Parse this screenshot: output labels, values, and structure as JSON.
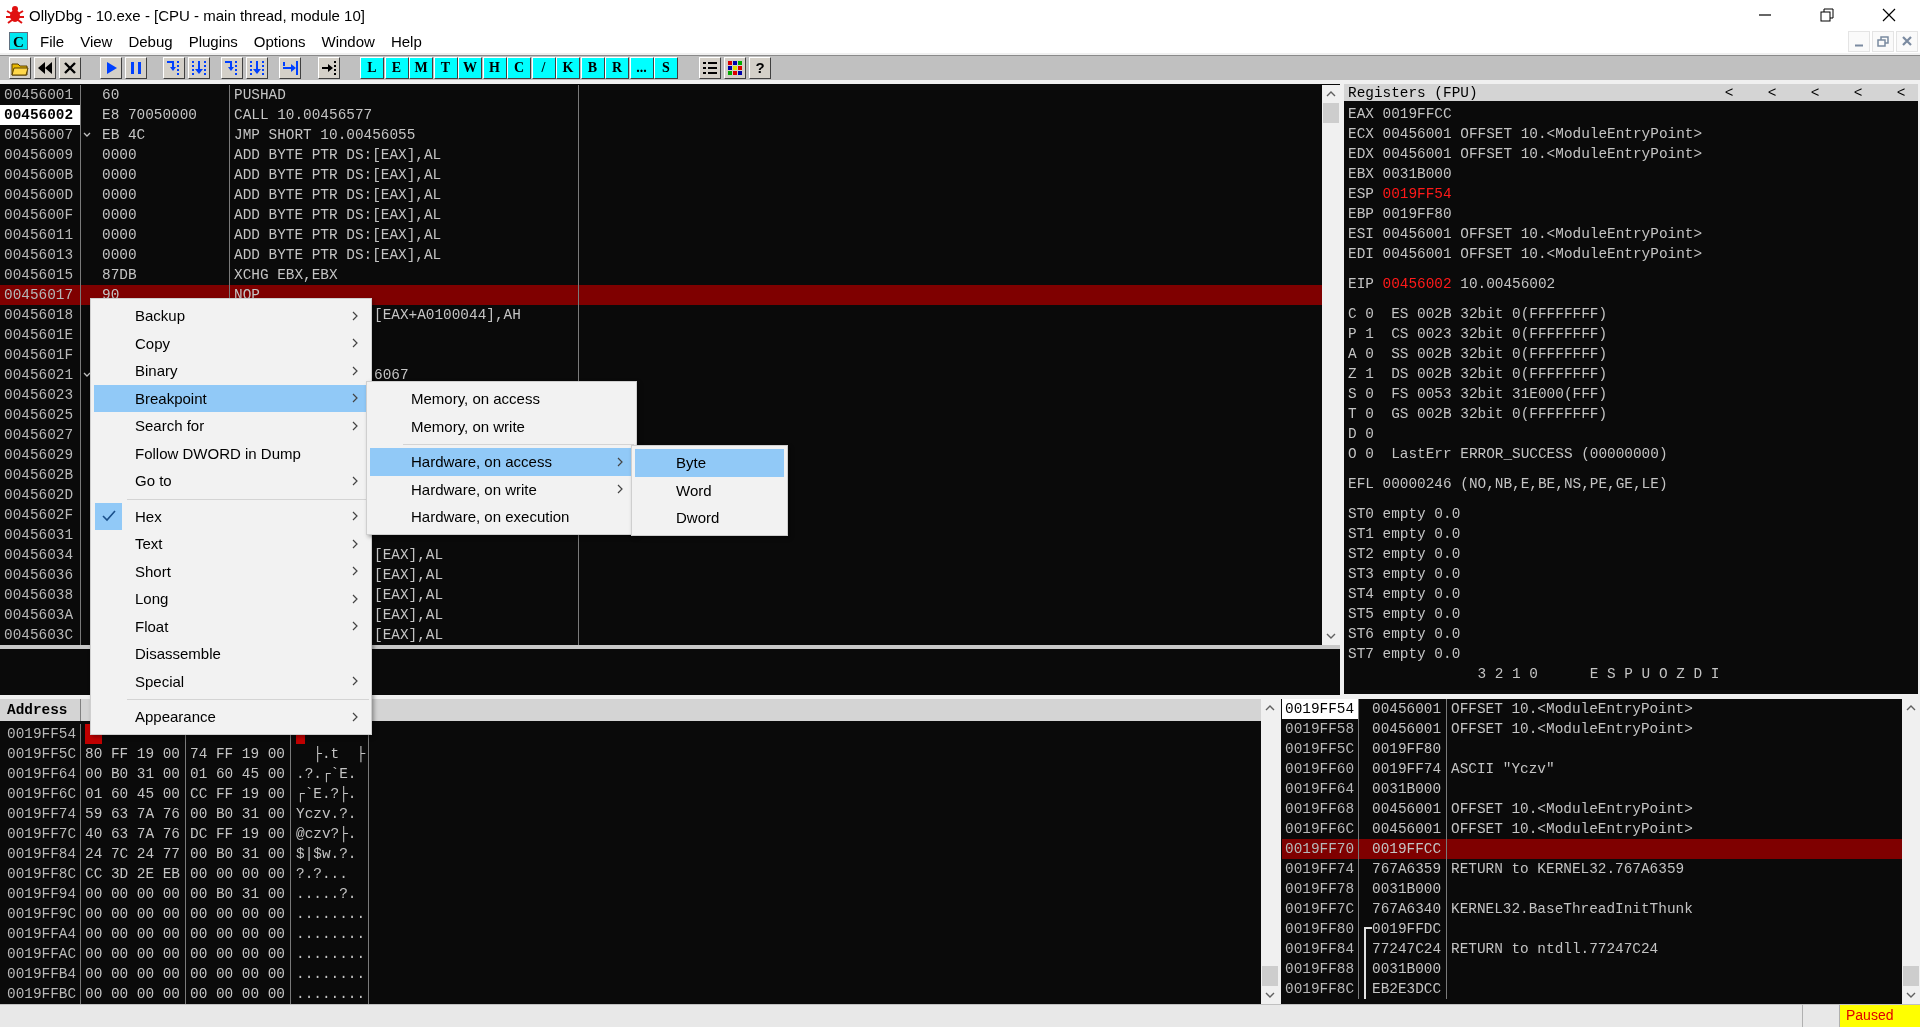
{
  "window": {
    "title": "OllyDbg - 10.exe - [CPU - main thread, module 10]"
  },
  "menu_bar": {
    "badge": "C",
    "items": [
      "File",
      "View",
      "Debug",
      "Plugins",
      "Options",
      "Window",
      "Help"
    ]
  },
  "toolbar": {
    "letter_buttons": [
      "L",
      "E",
      "M",
      "T",
      "W",
      "H",
      "C",
      "/",
      "K",
      "B",
      "R",
      "...",
      "S"
    ],
    "help_button": "?"
  },
  "disassembly": {
    "rows": [
      {
        "address": "00456001",
        "hex": "60",
        "command": "PUSHAD",
        "kind": "full",
        "current": false,
        "selected": false,
        "jump": false
      },
      {
        "address": "00456002",
        "hex": "E8 70050000",
        "command": "CALL 10.00456577",
        "kind": "full",
        "current": true,
        "selected": false,
        "jump": false
      },
      {
        "address": "00456007",
        "hex": "EB 4C",
        "command": "JMP SHORT 10.00456055",
        "kind": "full",
        "current": false,
        "selected": false,
        "jump": true
      },
      {
        "address": "00456009",
        "hex": "0000",
        "command": "ADD BYTE PTR DS:[EAX],AL",
        "kind": "full",
        "current": false,
        "selected": false,
        "jump": false
      },
      {
        "address": "0045600B",
        "hex": "0000",
        "command": "ADD BYTE PTR DS:[EAX],AL",
        "kind": "full",
        "current": false,
        "selected": false,
        "jump": false
      },
      {
        "address": "0045600D",
        "hex": "0000",
        "command": "ADD BYTE PTR DS:[EAX],AL",
        "kind": "full",
        "current": false,
        "selected": false,
        "jump": false
      },
      {
        "address": "0045600F",
        "hex": "0000",
        "command": "ADD BYTE PTR DS:[EAX],AL",
        "kind": "full",
        "current": false,
        "selected": false,
        "jump": false
      },
      {
        "address": "00456011",
        "hex": "0000",
        "command": "ADD BYTE PTR DS:[EAX],AL",
        "kind": "full",
        "current": false,
        "selected": false,
        "jump": false
      },
      {
        "address": "00456013",
        "hex": "0000",
        "command": "ADD BYTE PTR DS:[EAX],AL",
        "kind": "full",
        "current": false,
        "selected": false,
        "jump": false
      },
      {
        "address": "00456015",
        "hex": "87DB",
        "command": "XCHG EBX,EBX",
        "kind": "full",
        "current": false,
        "selected": false,
        "jump": false
      },
      {
        "address": "00456017",
        "hex": "90",
        "command": "NOP",
        "kind": "full",
        "current": false,
        "selected": true,
        "jump": false
      },
      {
        "address": "00456018",
        "command": "[EAX+A0100044],AH",
        "kind": "tail",
        "current": false,
        "selected": false,
        "jump": false
      },
      {
        "address": "0045601E",
        "kind": "tail",
        "current": false,
        "selected": false,
        "jump": false
      },
      {
        "address": "0045601F",
        "kind": "tail",
        "current": false,
        "selected": false,
        "jump": false
      },
      {
        "address": "00456021",
        "command": "6067",
        "kind": "tail",
        "current": false,
        "selected": false,
        "jump": true
      },
      {
        "address": "00456023",
        "kind": "tail",
        "current": false,
        "selected": false,
        "jump": false
      },
      {
        "address": "00456025",
        "kind": "tail",
        "current": false,
        "selected": false,
        "jump": false
      },
      {
        "address": "00456027",
        "kind": "tail",
        "current": false,
        "selected": false,
        "jump": false
      },
      {
        "address": "00456029",
        "kind": "tail",
        "current": false,
        "selected": false,
        "jump": false
      },
      {
        "address": "0045602B",
        "kind": "tail",
        "current": false,
        "selected": false,
        "jump": false
      },
      {
        "address": "0045602D",
        "kind": "tail",
        "current": false,
        "selected": false,
        "jump": false
      },
      {
        "address": "0045602F",
        "kind": "tail",
        "current": false,
        "selected": false,
        "jump": false
      },
      {
        "address": "00456031",
        "kind": "tail",
        "current": false,
        "selected": false,
        "jump": false
      },
      {
        "address": "00456034",
        "command": "[EAX],AL",
        "kind": "tail",
        "current": false,
        "selected": false,
        "jump": false
      },
      {
        "address": "00456036",
        "command": "[EAX],AL",
        "kind": "tail",
        "current": false,
        "selected": false,
        "jump": false
      },
      {
        "address": "00456038",
        "command": "[EAX],AL",
        "kind": "tail",
        "current": false,
        "selected": false,
        "jump": false
      },
      {
        "address": "0045603A",
        "command": "[EAX],AL",
        "kind": "tail",
        "current": false,
        "selected": false,
        "jump": false
      },
      {
        "address": "0045603C",
        "command": "[EAX],AL",
        "kind": "tail",
        "current": false,
        "selected": false,
        "jump": false
      }
    ]
  },
  "registers": {
    "title": "Registers (FPU)",
    "arrows": [
      "<",
      "<",
      "<",
      "<",
      "<"
    ],
    "groups": [
      [
        {
          "kind": "reg",
          "name": "EAX",
          "value": "0019FFCC",
          "changed": false
        },
        {
          "kind": "reg",
          "name": "ECX",
          "value": "00456001",
          "comment": "OFFSET 10.<ModuleEntryPoint>",
          "changed": false
        },
        {
          "kind": "reg",
          "name": "EDX",
          "value": "00456001",
          "comment": "OFFSET 10.<ModuleEntryPoint>",
          "changed": false
        },
        {
          "kind": "reg",
          "name": "EBX",
          "value": "0031B000",
          "changed": false
        },
        {
          "kind": "reg",
          "name": "ESP",
          "value": "0019FF54",
          "changed": true
        },
        {
          "kind": "reg",
          "name": "EBP",
          "value": "0019FF80",
          "changed": false
        },
        {
          "kind": "reg",
          "name": "ESI",
          "value": "00456001",
          "comment": "OFFSET 10.<ModuleEntryPoint>",
          "changed": false
        },
        {
          "kind": "reg",
          "name": "EDI",
          "value": "00456001",
          "comment": "OFFSET 10.<ModuleEntryPoint>",
          "changed": false
        }
      ],
      [
        {
          "kind": "reg",
          "name": "EIP",
          "value": "00456002",
          "comment": "10.00456002",
          "changed": true
        }
      ],
      [
        {
          "kind": "flag",
          "name": "C",
          "value": "0",
          "comment": "ES 002B 32bit 0(FFFFFFFF)",
          "changed": false
        },
        {
          "kind": "flag",
          "name": "P",
          "value": "1",
          "comment": "CS 0023 32bit 0(FFFFFFFF)",
          "changed": false
        },
        {
          "kind": "flag",
          "name": "A",
          "value": "0",
          "comment": "SS 002B 32bit 0(FFFFFFFF)",
          "changed": false
        },
        {
          "kind": "flag",
          "name": "Z",
          "value": "1",
          "comment": "DS 002B 32bit 0(FFFFFFFF)",
          "changed": false
        },
        {
          "kind": "flag",
          "name": "S",
          "value": "0",
          "comment": "FS 0053 32bit 31E000(FFF)",
          "changed": false
        },
        {
          "kind": "flag",
          "name": "T",
          "value": "0",
          "comment": "GS 002B 32bit 0(FFFFFFFF)",
          "changed": false
        },
        {
          "kind": "flag",
          "name": "D",
          "value": "0",
          "changed": false
        },
        {
          "kind": "flag",
          "name": "O",
          "value": "0",
          "comment": "LastErr ERROR_SUCCESS (00000000)",
          "changed": false
        }
      ],
      [
        {
          "kind": "reg",
          "name": "EFL",
          "value": "00000246",
          "comment": "(NO,NB,E,BE,NS,PE,GE,LE)",
          "changed": false
        }
      ],
      [
        {
          "kind": "reg",
          "name": "ST0",
          "value": "empty",
          "comment": "0.0",
          "changed": false
        },
        {
          "kind": "reg",
          "name": "ST1",
          "value": "empty",
          "comment": "0.0",
          "changed": false
        },
        {
          "kind": "reg",
          "name": "ST2",
          "value": "empty",
          "comment": "0.0",
          "changed": false
        },
        {
          "kind": "reg",
          "name": "ST3",
          "value": "empty",
          "comment": "0.0",
          "changed": false
        },
        {
          "kind": "reg",
          "name": "ST4",
          "value": "empty",
          "comment": "0.0",
          "changed": false
        },
        {
          "kind": "reg",
          "name": "ST5",
          "value": "empty",
          "comment": "0.0",
          "changed": false
        },
        {
          "kind": "reg",
          "name": "ST6",
          "value": "empty",
          "comment": "0.0",
          "changed": false
        },
        {
          "kind": "reg",
          "name": "ST7",
          "value": "empty",
          "comment": "0.0",
          "changed": false
        },
        {
          "kind": "footer",
          "text": "3 2 1 0      E S P U O Z D I",
          "changed": false
        }
      ]
    ]
  },
  "dump": {
    "columns": [
      "Address"
    ],
    "rows": [
      {
        "address": "0019FF54",
        "cursor": true
      },
      {
        "address": "0019FF5C",
        "hex": [
          "80",
          "FF",
          "19",
          "00",
          "74",
          "FF",
          "19",
          "00"
        ],
        "ascii": "  ├.t  ├",
        "cursor": false
      },
      {
        "address": "0019FF64",
        "hex": [
          "00",
          "B0",
          "31",
          "00",
          "01",
          "60",
          "45",
          "00"
        ],
        "ascii": ".?.┌`E.",
        "cursor": false
      },
      {
        "address": "0019FF6C",
        "hex": [
          "01",
          "60",
          "45",
          "00",
          "CC",
          "FF",
          "19",
          "00"
        ],
        "ascii": "┌`E.?├.",
        "cursor": false
      },
      {
        "address": "0019FF74",
        "hex": [
          "59",
          "63",
          "7A",
          "76",
          "00",
          "B0",
          "31",
          "00"
        ],
        "ascii": "Yczv.?.",
        "cursor": false
      },
      {
        "address": "0019FF7C",
        "hex": [
          "40",
          "63",
          "7A",
          "76",
          "DC",
          "FF",
          "19",
          "00"
        ],
        "ascii": "@czv?├.",
        "cursor": false
      },
      {
        "address": "0019FF84",
        "hex": [
          "24",
          "7C",
          "24",
          "77",
          "00",
          "B0",
          "31",
          "00"
        ],
        "ascii": "$|$w.?.",
        "cursor": false
      },
      {
        "address": "0019FF8C",
        "hex": [
          "CC",
          "3D",
          "2E",
          "EB",
          "00",
          "00",
          "00",
          "00"
        ],
        "ascii": "?.?...",
        "cursor": false
      },
      {
        "address": "0019FF94",
        "hex": [
          "00",
          "00",
          "00",
          "00",
          "00",
          "B0",
          "31",
          "00"
        ],
        "ascii": ".....?.",
        "cursor": false
      },
      {
        "address": "0019FF9C",
        "hex": [
          "00",
          "00",
          "00",
          "00",
          "00",
          "00",
          "00",
          "00"
        ],
        "ascii": "........",
        "cursor": false
      },
      {
        "address": "0019FFA4",
        "hex": [
          "00",
          "00",
          "00",
          "00",
          "00",
          "00",
          "00",
          "00"
        ],
        "ascii": "........",
        "cursor": false
      },
      {
        "address": "0019FFAC",
        "hex": [
          "00",
          "00",
          "00",
          "00",
          "00",
          "00",
          "00",
          "00"
        ],
        "ascii": "........",
        "cursor": false
      },
      {
        "address": "0019FFB4",
        "hex": [
          "00",
          "00",
          "00",
          "00",
          "00",
          "00",
          "00",
          "00"
        ],
        "ascii": "........",
        "cursor": false
      },
      {
        "address": "0019FFBC",
        "hex": [
          "00",
          "00",
          "00",
          "00",
          "00",
          "00",
          "00",
          "00"
        ],
        "ascii": "........",
        "cursor": false
      }
    ]
  },
  "stack": {
    "rows": [
      {
        "address": "0019FF54",
        "value": "00456001",
        "comment": "OFFSET 10.<ModuleEntryPoint>",
        "top": true,
        "selected": false,
        "frame": false
      },
      {
        "address": "0019FF58",
        "value": "00456001",
        "comment": "OFFSET 10.<ModuleEntryPoint>",
        "top": false,
        "selected": false,
        "frame": false
      },
      {
        "address": "0019FF5C",
        "value": "0019FF80",
        "top": false,
        "selected": false,
        "frame": false
      },
      {
        "address": "0019FF60",
        "value": "0019FF74",
        "comment": "ASCII \"Yczv\"",
        "top": false,
        "selected": false,
        "frame": false
      },
      {
        "address": "0019FF64",
        "value": "0031B000",
        "top": false,
        "selected": false,
        "frame": false
      },
      {
        "address": "0019FF68",
        "value": "00456001",
        "comment": "OFFSET 10.<ModuleEntryPoint>",
        "top": false,
        "selected": false,
        "frame": false
      },
      {
        "address": "0019FF6C",
        "value": "00456001",
        "comment": "OFFSET 10.<ModuleEntryPoint>",
        "top": false,
        "selected": false,
        "frame": false
      },
      {
        "address": "0019FF70",
        "value": "0019FFCC",
        "top": false,
        "selected": true,
        "frame": false
      },
      {
        "address": "0019FF74",
        "value": "767A6359",
        "comment": "RETURN to KERNEL32.767A6359",
        "top": false,
        "selected": false,
        "frame": false
      },
      {
        "address": "0019FF78",
        "value": "0031B000",
        "top": false,
        "selected": false,
        "frame": false
      },
      {
        "address": "0019FF7C",
        "value": "767A6340",
        "comment": "KERNEL32.BaseThreadInitThunk",
        "top": false,
        "selected": false,
        "frame": false
      },
      {
        "address": "0019FF80",
        "value": "0019FFDC",
        "top": false,
        "selected": false,
        "frame": true
      },
      {
        "address": "0019FF84",
        "value": "77247C24",
        "comment": "RETURN to ntdll.77247C24",
        "top": false,
        "selected": false,
        "frame": true
      },
      {
        "address": "0019FF88",
        "value": "0031B000",
        "top": false,
        "selected": false,
        "frame": true
      },
      {
        "address": "0019FF8C",
        "value": "EB2E3DCC",
        "top": false,
        "selected": false,
        "frame": true
      }
    ]
  },
  "status_bar": {
    "state": "Paused"
  },
  "context_menu": {
    "items": [
      {
        "kind": "item",
        "label": "Backup",
        "submenu": true,
        "selected": false,
        "checked": false
      },
      {
        "kind": "item",
        "label": "Copy",
        "submenu": true,
        "selected": false,
        "checked": false
      },
      {
        "kind": "item",
        "label": "Binary",
        "submenu": true,
        "selected": false,
        "checked": false
      },
      {
        "kind": "item",
        "label": "Breakpoint",
        "submenu": true,
        "selected": true,
        "checked": false
      },
      {
        "kind": "item",
        "label": "Search for",
        "submenu": true,
        "selected": false,
        "checked": false
      },
      {
        "kind": "item",
        "label": "Follow DWORD in Dump",
        "submenu": false,
        "selected": false,
        "checked": false
      },
      {
        "kind": "item",
        "label": "Go to",
        "submenu": true,
        "selected": false,
        "checked": false
      },
      {
        "kind": "separator"
      },
      {
        "kind": "item",
        "label": "Hex",
        "submenu": true,
        "selected": false,
        "checked": true
      },
      {
        "kind": "item",
        "label": "Text",
        "submenu": true,
        "selected": false,
        "checked": false
      },
      {
        "kind": "item",
        "label": "Short",
        "submenu": true,
        "selected": false,
        "checked": false
      },
      {
        "kind": "item",
        "label": "Long",
        "submenu": true,
        "selected": false,
        "checked": false
      },
      {
        "kind": "item",
        "label": "Float",
        "submenu": true,
        "selected": false,
        "checked": false
      },
      {
        "kind": "item",
        "label": "Disassemble",
        "submenu": false,
        "selected": false,
        "checked": false
      },
      {
        "kind": "item",
        "label": "Special",
        "submenu": true,
        "selected": false,
        "checked": false
      },
      {
        "kind": "separator"
      },
      {
        "kind": "item",
        "label": "Appearance",
        "submenu": true,
        "selected": false,
        "checked": false
      }
    ]
  },
  "breakpoint_menu": {
    "items": [
      {
        "kind": "item",
        "label": "Memory, on access",
        "submenu": false,
        "selected": false,
        "checked": false
      },
      {
        "kind": "item",
        "label": "Memory, on write",
        "submenu": false,
        "selected": false,
        "checked": false
      },
      {
        "kind": "separator"
      },
      {
        "kind": "item",
        "label": "Hardware, on access",
        "submenu": true,
        "selected": true,
        "checked": false
      },
      {
        "kind": "item",
        "label": "Hardware, on write",
        "submenu": true,
        "selected": false,
        "checked": false
      },
      {
        "kind": "item",
        "label": "Hardware, on execution",
        "submenu": false,
        "selected": false,
        "checked": false
      }
    ]
  },
  "size_menu": {
    "items": [
      {
        "kind": "item",
        "label": "Byte",
        "submenu": false,
        "selected": true,
        "checked": false
      },
      {
        "kind": "item",
        "label": "Word",
        "submenu": false,
        "selected": false,
        "checked": false
      },
      {
        "kind": "item",
        "label": "Dword",
        "submenu": false,
        "selected": false,
        "checked": false
      }
    ]
  }
}
